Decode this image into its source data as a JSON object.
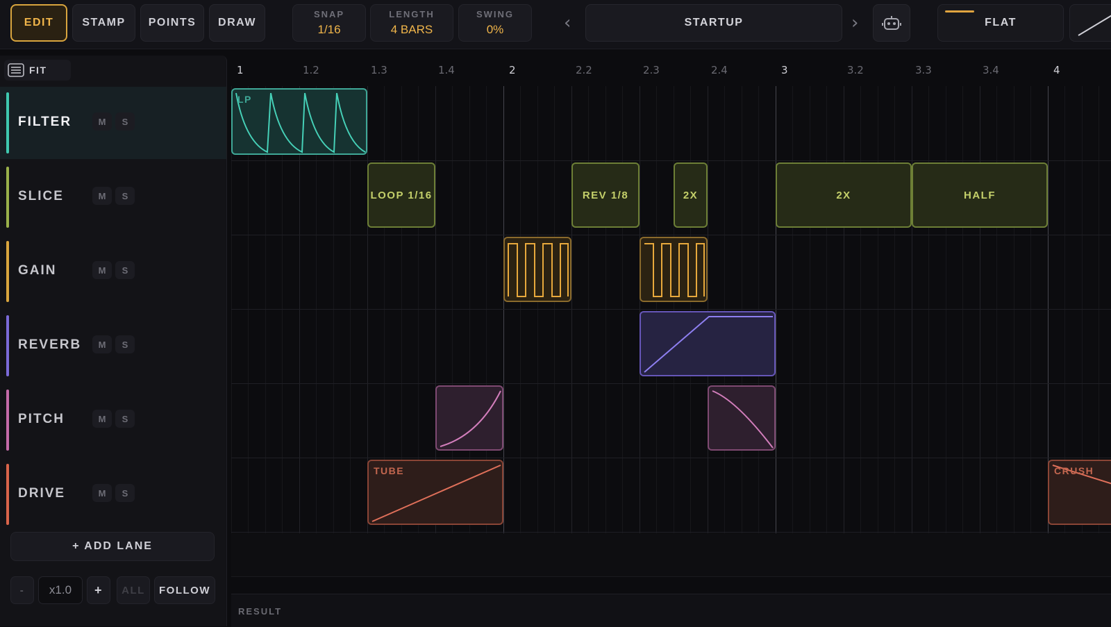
{
  "toolbar": {
    "modes": [
      {
        "label": "EDIT",
        "active": true
      },
      {
        "label": "STAMP",
        "active": false
      },
      {
        "label": "POINTS",
        "active": false
      },
      {
        "label": "DRAW",
        "active": false
      }
    ],
    "snap": {
      "label": "SNAP",
      "value": "1/16"
    },
    "length": {
      "label": "LENGTH",
      "value": "4 BARS"
    },
    "swing": {
      "label": "SWING",
      "value": "0%"
    },
    "preset": "STARTUP",
    "prev_icon": "chevron-left-icon",
    "next_icon": "chevron-right-icon",
    "robot_icon": "robot-icon",
    "curve": "FLAT"
  },
  "sidebar": {
    "fit_label": "FIT",
    "lanes": [
      {
        "name": "FILTER",
        "color": "#3fc9b0",
        "selected": true,
        "mute": "M",
        "solo": "S"
      },
      {
        "name": "SLICE",
        "color": "#9ab04a",
        "selected": false,
        "mute": "M",
        "solo": "S"
      },
      {
        "name": "GAIN",
        "color": "#d9a53e",
        "selected": false,
        "mute": "M",
        "solo": "S"
      },
      {
        "name": "REVERB",
        "color": "#7b6ad8",
        "selected": false,
        "mute": "M",
        "solo": "S"
      },
      {
        "name": "PITCH",
        "color": "#c46aa8",
        "selected": false,
        "mute": "M",
        "solo": "S"
      },
      {
        "name": "DRIVE",
        "color": "#d9644a",
        "selected": false,
        "mute": "M",
        "solo": "S"
      }
    ],
    "add_lane": "+ ADD LANE",
    "zoom_out": "-",
    "zoom_value": "x1.0",
    "zoom_in": "+",
    "all": "ALL",
    "follow": "FOLLOW"
  },
  "ruler": {
    "ticks": [
      "1",
      "1.2",
      "1.3",
      "1.4",
      "2",
      "2.2",
      "2.3",
      "2.4",
      "3",
      "3.2",
      "3.3",
      "3.4",
      "4"
    ]
  },
  "clips": {
    "filter_tag": "LP",
    "slice": [
      "LOOP 1/16",
      "REV 1/8",
      "2X",
      "2X",
      "HALF"
    ],
    "drive": [
      "TUBE",
      "CRUSH"
    ]
  },
  "result_label": "RESULT"
}
